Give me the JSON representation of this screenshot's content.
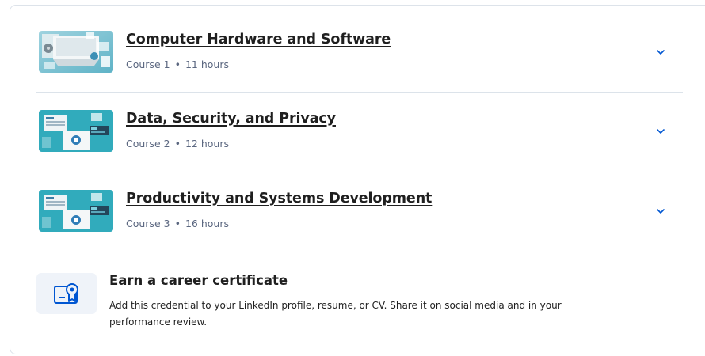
{
  "courses": [
    {
      "title": "Computer Hardware and Software",
      "course_label": "Course 1",
      "duration": "11 hours",
      "thumbnail": "hardware-thumbnail-icon",
      "expand_icon": "chevron-down-icon"
    },
    {
      "title": "Data, Security, and Privacy",
      "course_label": "Course 2",
      "duration": "12 hours",
      "thumbnail": "security-thumbnail-icon",
      "expand_icon": "chevron-down-icon"
    },
    {
      "title": "Productivity and Systems Development",
      "course_label": "Course 3",
      "duration": "16 hours",
      "thumbnail": "security-thumbnail-icon",
      "expand_icon": "chevron-down-icon"
    }
  ],
  "separator": "•",
  "certificate": {
    "icon": "certificate-icon",
    "title": "Earn a career certificate",
    "description": "Add this credential to your LinkedIn profile, resume, or CV. Share it on social media and in your performance review."
  },
  "colors": {
    "accent": "#0056d2",
    "title_text": "#1f1f1f",
    "meta_text": "#5b6780",
    "divider": "#dce3ea",
    "cert_icon_bg": "#eff3f9"
  }
}
